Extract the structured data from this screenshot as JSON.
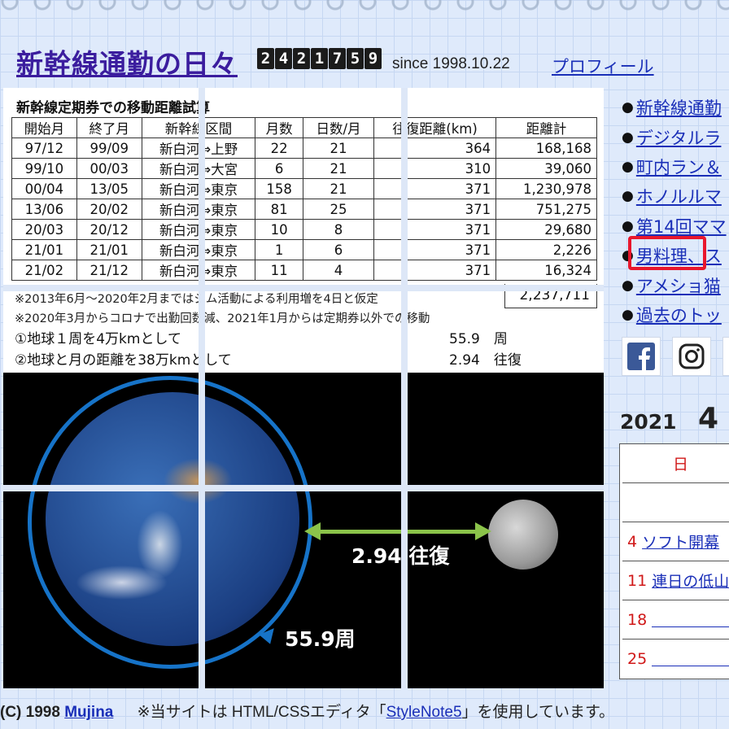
{
  "header": {
    "site_title": "新幹線通勤の日々",
    "counter_digits": [
      "2",
      "4",
      "2",
      "1",
      "7",
      "5",
      "9"
    ],
    "since": "since 1998.10.22",
    "profile_link": "プロフィール"
  },
  "article_image": {
    "table_title": "新幹線定期券での移動距離試算",
    "columns": [
      "開始月",
      "終了月",
      "新幹線区間",
      "月数",
      "日数/月",
      "往復距離(km)",
      "距離計"
    ],
    "rows": [
      [
        "97/12",
        "99/09",
        "新白河⇔上野",
        "22",
        "21",
        "364",
        "168,168"
      ],
      [
        "99/10",
        "00/03",
        "新白河⇔大宮",
        "6",
        "21",
        "310",
        "39,060"
      ],
      [
        "00/04",
        "13/05",
        "新白河⇔東京",
        "158",
        "21",
        "371",
        "1,230,978"
      ],
      [
        "13/06",
        "20/02",
        "新白河⇔東京",
        "81",
        "25",
        "371",
        "751,275"
      ],
      [
        "20/03",
        "20/12",
        "新白河⇔東京",
        "10",
        "8",
        "371",
        "29,680"
      ],
      [
        "21/01",
        "21/01",
        "新白河⇔東京",
        "1",
        "6",
        "371",
        "2,226"
      ],
      [
        "21/02",
        "21/12",
        "新白河⇔東京",
        "11",
        "4",
        "371",
        "16,324"
      ]
    ],
    "total": "2,237,711",
    "note1": "※2013年6月～2020年2月まではジム活動による利用増を4日と仮定",
    "note2": "※2020年3月からコロナで出勤回数減、2021年1月からは定期券以外での移動",
    "calc1_label": "①地球１周を4万kmとして",
    "calc1_value": "55.9　周",
    "calc2_label": "②地球と月の距離を38万kmとして",
    "calc2_value": "2.94　往復",
    "trip_label": "2.94 往復",
    "lap_label": "55.9周"
  },
  "nav": {
    "items": [
      "新幹線通勤",
      "デジタルラ",
      "町内ラン＆",
      "ホノルルマ",
      "第14回ママ",
      "男料理",
      "アメショ猫",
      "過去のトッ"
    ],
    "item6_suffix": "、ス"
  },
  "calendar": {
    "year": "2021",
    "month": "4",
    "header_day": "日",
    "rows": [
      {
        "day": "",
        "event": ""
      },
      {
        "day": "4",
        "event": "ソフト開幕"
      },
      {
        "day": "11",
        "event": "連日の低山"
      },
      {
        "day": "18",
        "event": ""
      },
      {
        "day": "25",
        "event": ""
      }
    ]
  },
  "footer": {
    "copyright": "(C) 1998",
    "author_link": "Mujina",
    "text_before": "※当サイトは HTML/CSSエディタ「",
    "editor_link": "StyleNote5",
    "text_after": "」を使用しています。"
  },
  "colors": {
    "title": "#3b1d9e",
    "link": "#1a2fb8",
    "highlight": "#e8162c",
    "orbit": "#1673c8",
    "arrow": "#8bc34a"
  }
}
